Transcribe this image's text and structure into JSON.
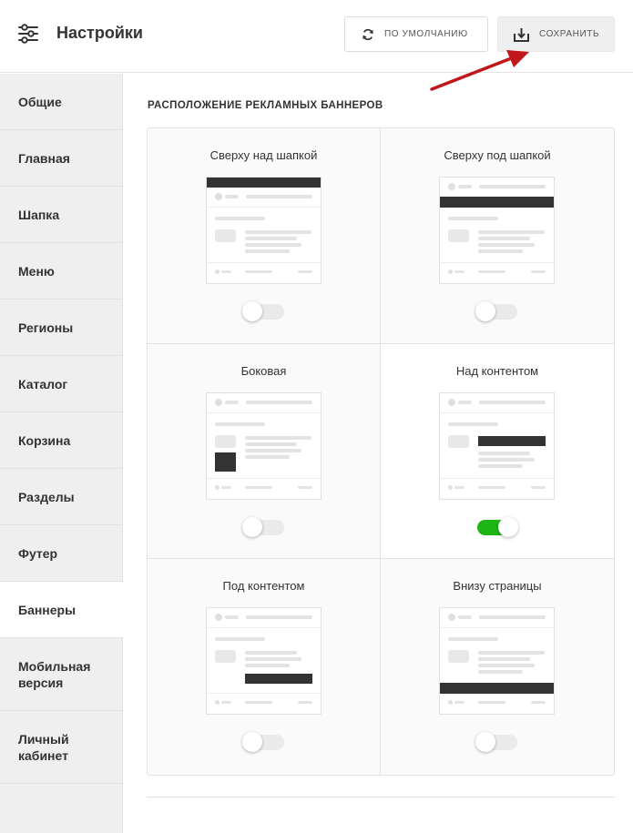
{
  "header": {
    "title": "Настройки",
    "default_button": "По умолчанию",
    "save_button": "Сохранить"
  },
  "sidebar": {
    "items": [
      {
        "label": "Общие"
      },
      {
        "label": "Главная"
      },
      {
        "label": "Шапка"
      },
      {
        "label": "Меню"
      },
      {
        "label": "Регионы"
      },
      {
        "label": "Каталог"
      },
      {
        "label": "Корзина"
      },
      {
        "label": "Разделы"
      },
      {
        "label": "Футер"
      },
      {
        "label": "Баннеры"
      },
      {
        "label": "Мобильная\nверсия"
      },
      {
        "label": "Личный\nкабинет"
      }
    ],
    "active": "Баннеры"
  },
  "main": {
    "section_title": "Расположение рекламных баннеров",
    "options": [
      {
        "label": "Сверху над шапкой",
        "enabled": false
      },
      {
        "label": "Сверху под шапкой",
        "enabled": false
      },
      {
        "label": "Боковая",
        "enabled": false
      },
      {
        "label": "Над контентом",
        "enabled": true
      },
      {
        "label": "Под контентом",
        "enabled": false
      },
      {
        "label": "Внизу страницы",
        "enabled": false
      }
    ]
  },
  "colors": {
    "toggle_on": "#1cb515",
    "arrow": "#c0181a",
    "banner_block": "#333333"
  }
}
